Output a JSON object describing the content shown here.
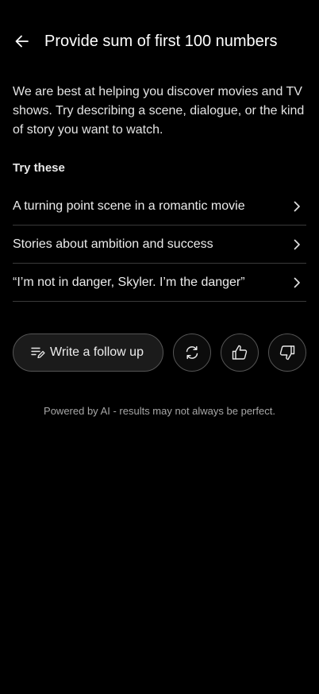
{
  "header": {
    "title": "Provide sum of first 100 numbers",
    "back_icon": "arrow-left-icon"
  },
  "intro": {
    "text": "We are best at helping you discover movies and TV shows. Try describing a scene, dialogue, or the kind of story you want to watch."
  },
  "suggestions": {
    "heading": "Try these",
    "items": [
      {
        "label": "A turning point scene in a romantic movie",
        "icon": "chevron-right-icon"
      },
      {
        "label": "Stories about ambition and success",
        "icon": "chevron-right-icon"
      },
      {
        "label": "“I’m not in danger, Skyler. I’m the danger”",
        "icon": "chevron-right-icon"
      }
    ]
  },
  "actions": {
    "followup_label": "Write a follow up",
    "followup_icon": "edit-list-icon",
    "regenerate_icon": "refresh-icon",
    "thumbs_up_icon": "thumbs-up-icon",
    "thumbs_down_icon": "thumbs-down-icon"
  },
  "footer": {
    "disclaimer": "Powered by AI - results may not always be perfect."
  },
  "colors": {
    "background": "#000000",
    "text": "#ffffff",
    "muted_text": "#a7a7a7",
    "divider": "#3a3a3a",
    "button_border": "#555555"
  }
}
